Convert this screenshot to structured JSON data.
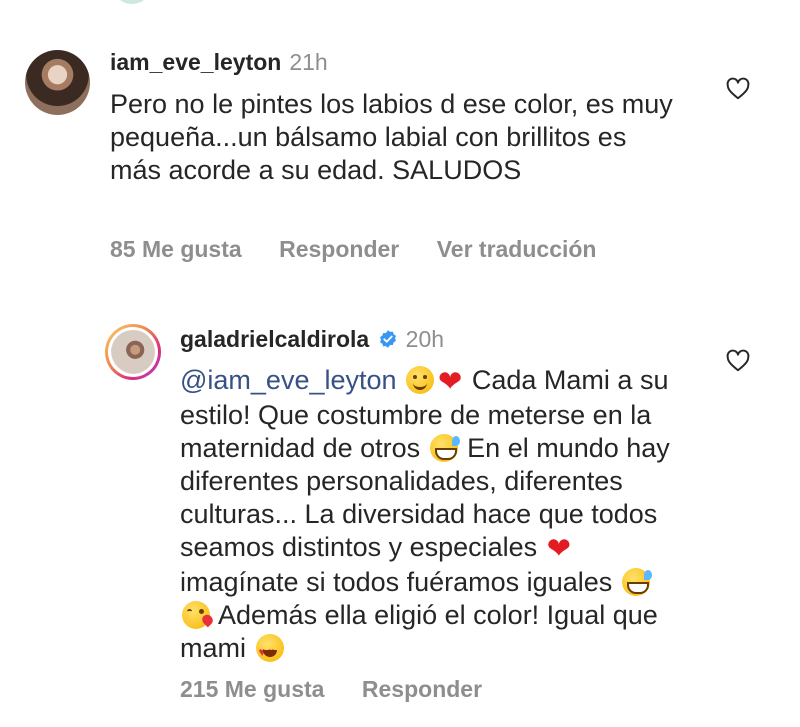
{
  "comments": [
    {
      "username": "iam_eve_leyton",
      "time": "21h",
      "text": "Pero no le pintes los labios d ese color, es muy pequeña...un bálsamo labial con brillitos es más acorde a su edad. SALUDOS",
      "likes": "85 Me gusta",
      "reply": "Responder",
      "translate": "Ver traducción"
    },
    {
      "username": "galadrielcaldirola",
      "verified": true,
      "time": "20h",
      "mention": "@iam_eve_leyton",
      "text_parts": [
        "Cada Mami a su estilo! Que costumbre de meterse en la maternidad de otros",
        "En el mundo hay diferentes personalidades, diferentes culturas... La diversidad hace que todos seamos distintos y especiales",
        "imagínate si todos fuéramos iguales",
        "Además ella eligió el color! Igual que mami"
      ],
      "likes": "215 Me gusta",
      "reply": "Responder"
    }
  ],
  "colors": {
    "text": "#262626",
    "muted": "#8e8e8e",
    "mention": "#385185",
    "verified": "#3897f0"
  },
  "icons": [
    "heart-outline-icon",
    "verified-badge-icon",
    "smiling-face-emoji",
    "red-heart-emoji",
    "grinning-sweat-emoji",
    "kissing-heart-emoji",
    "heart-eyes-emoji"
  ]
}
